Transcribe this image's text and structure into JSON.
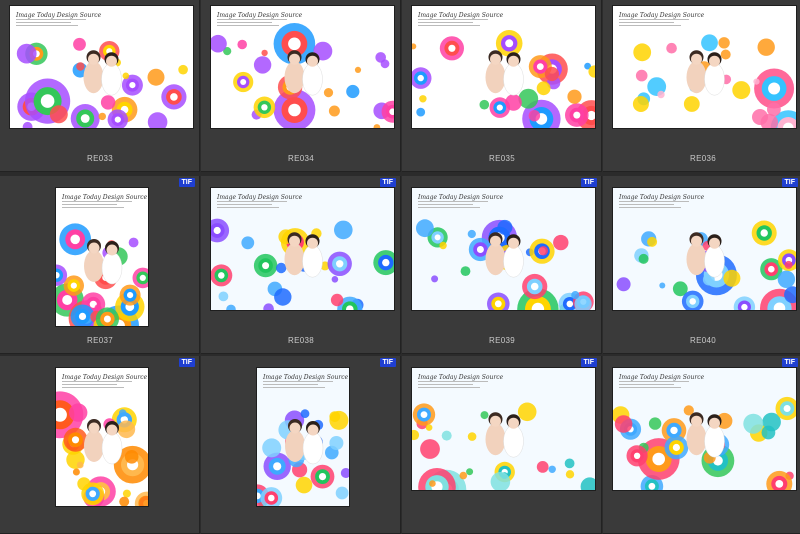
{
  "badge_label": "TIF",
  "thumb_heading": "Image Today Design Source",
  "items": [
    {
      "name": "RE033",
      "badge": "",
      "orientation": "land",
      "theme": "rainbow"
    },
    {
      "name": "RE034",
      "badge": "",
      "orientation": "land",
      "theme": "rainbow"
    },
    {
      "name": "RE035",
      "badge": "",
      "orientation": "land",
      "theme": "rainbow"
    },
    {
      "name": "RE036",
      "badge": "",
      "orientation": "land",
      "theme": "pink"
    },
    {
      "name": "RE037",
      "badge": "TIF",
      "orientation": "port",
      "theme": "rainbow"
    },
    {
      "name": "RE038",
      "badge": "TIF",
      "orientation": "land",
      "theme": "blue"
    },
    {
      "name": "RE039",
      "badge": "TIF",
      "orientation": "land",
      "theme": "blue"
    },
    {
      "name": "RE040",
      "badge": "TIF",
      "orientation": "land",
      "theme": "blue"
    },
    {
      "name": "",
      "badge": "TIF",
      "orientation": "port",
      "theme": "orange"
    },
    {
      "name": "",
      "badge": "TIF",
      "orientation": "port",
      "theme": "blue"
    },
    {
      "name": "",
      "badge": "TIF",
      "orientation": "land",
      "theme": "aqua"
    },
    {
      "name": "",
      "badge": "TIF",
      "orientation": "land",
      "theme": "aqua"
    }
  ],
  "colors": {
    "background": "#2b2b2b",
    "cell": "#3a3a3a",
    "badge": "#1f3fd1",
    "caption": "#c9c9c9"
  }
}
